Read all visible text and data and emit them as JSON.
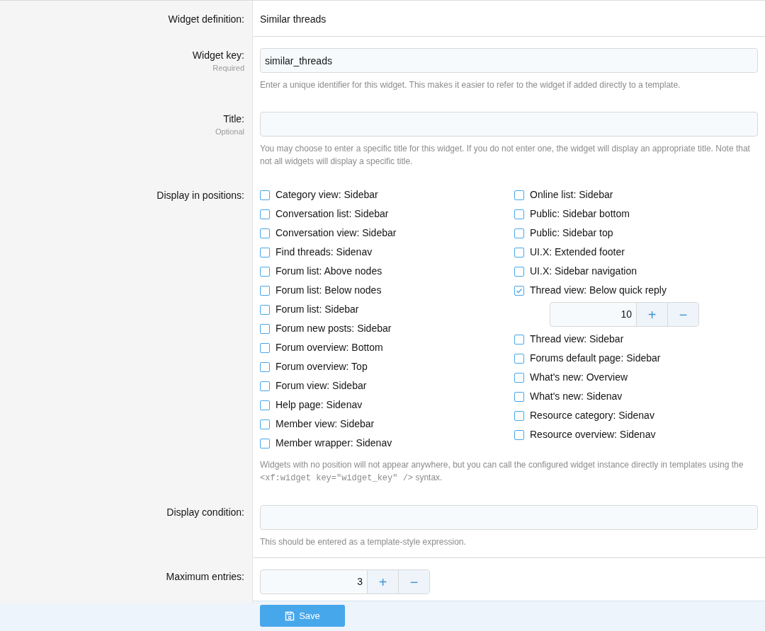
{
  "rows": [
    {
      "kind": "static",
      "label": "Widget definition:",
      "value": "Similar threads",
      "divider": true
    },
    {
      "kind": "text",
      "label": "Widget key:",
      "note": "Required",
      "value": "similar_threads",
      "hint": "Enter a unique identifier for this widget. This makes it easier to refer to the widget if added directly to a template."
    },
    {
      "kind": "text",
      "label": "Title:",
      "note": "Optional",
      "value": "",
      "hint": "You may choose to enter a specific title for this widget. If you do not enter one, the widget will display an appropriate title. Note that not all widgets will display a specific title."
    },
    {
      "kind": "checkboxes",
      "label": "Display in positions:",
      "columns": [
        [
          {
            "label": "Category view: Sidebar",
            "checked": false
          },
          {
            "label": "Conversation list: Sidebar",
            "checked": false
          },
          {
            "label": "Conversation view: Sidebar",
            "checked": false
          },
          {
            "label": "Find threads: Sidenav",
            "checked": false
          },
          {
            "label": "Forum list: Above nodes",
            "checked": false
          },
          {
            "label": "Forum list: Below nodes",
            "checked": false
          },
          {
            "label": "Forum list: Sidebar",
            "checked": false
          },
          {
            "label": "Forum new posts: Sidebar",
            "checked": false
          },
          {
            "label": "Forum overview: Bottom",
            "checked": false
          },
          {
            "label": "Forum overview: Top",
            "checked": false
          },
          {
            "label": "Forum view: Sidebar",
            "checked": false
          },
          {
            "label": "Help page: Sidenav",
            "checked": false
          },
          {
            "label": "Member view: Sidebar",
            "checked": false
          },
          {
            "label": "Member wrapper: Sidenav",
            "checked": false
          }
        ],
        [
          {
            "label": "Online list: Sidebar",
            "checked": false
          },
          {
            "label": "Public: Sidebar bottom",
            "checked": false
          },
          {
            "label": "Public: Sidebar top",
            "checked": false
          },
          {
            "label": "UI.X: Extended footer",
            "checked": false
          },
          {
            "label": "UI.X: Sidebar navigation",
            "checked": false
          },
          {
            "label": "Thread view: Below quick reply",
            "checked": true,
            "order": "10",
            "plus": "+",
            "minus": "−"
          },
          {
            "label": "Thread view: Sidebar",
            "checked": false
          },
          {
            "label": "Forums default page: Sidebar",
            "checked": false
          },
          {
            "label": "What's new: Overview",
            "checked": false
          },
          {
            "label": "What's new: Sidenav",
            "checked": false
          },
          {
            "label": "Resource category: Sidenav",
            "checked": false
          },
          {
            "label": "Resource overview: Sidenav",
            "checked": false
          }
        ]
      ],
      "hint_parts": [
        {
          "kind": "text",
          "text": "Widgets with no position will not appear anywhere, but you can call the configured widget instance directly in templates using the "
        },
        {
          "kind": "code",
          "text": "<xf:widget key=\"widget_key\" />"
        },
        {
          "kind": "text",
          "text": " syntax."
        }
      ]
    },
    {
      "kind": "text",
      "label": "Display condition:",
      "value": "",
      "hint": "This should be entered as a template-style expression.",
      "divider": true
    },
    {
      "kind": "number",
      "label": "Maximum entries:",
      "value": "3",
      "plus": "+",
      "minus": "−"
    }
  ],
  "save": {
    "label": "Save"
  }
}
